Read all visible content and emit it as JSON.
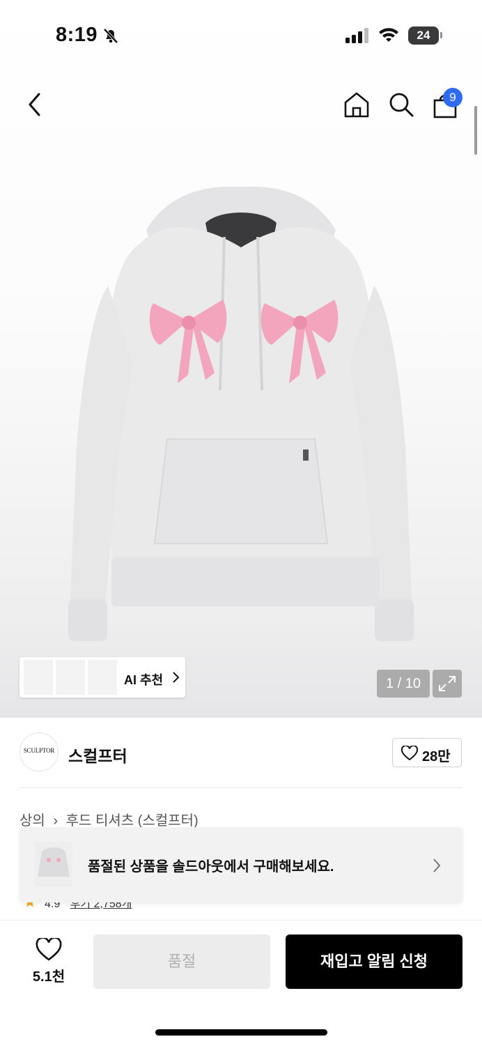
{
  "status_bar": {
    "time": "8:19",
    "battery": "24"
  },
  "nav": {
    "back": "back",
    "home": "home",
    "search": "search",
    "cart_badge": "9"
  },
  "gallery": {
    "ai_label": "AI 추천",
    "pager": "1 / 10"
  },
  "brand": {
    "logo_text": "SCULPTOR",
    "name": "스컬프터",
    "likes": "28만"
  },
  "breadcrumb": {
    "category": "상의",
    "subcategory": "후드 티셔츠 (스컬프터)"
  },
  "rating": {
    "value": "4.9",
    "reviews": "후기 2,758개"
  },
  "banner": {
    "text": "품절된 상품을 솔드아웃에서 구매해보세요."
  },
  "bottom": {
    "wish_count": "5.1천",
    "soldout_label": "품절",
    "restock_label": "재입고 알림 신청"
  },
  "colors": {
    "accent_blue": "#2f6bf0",
    "bow_pink": "#f3a5bd",
    "hoodie_gray": "#e9e9ea"
  }
}
